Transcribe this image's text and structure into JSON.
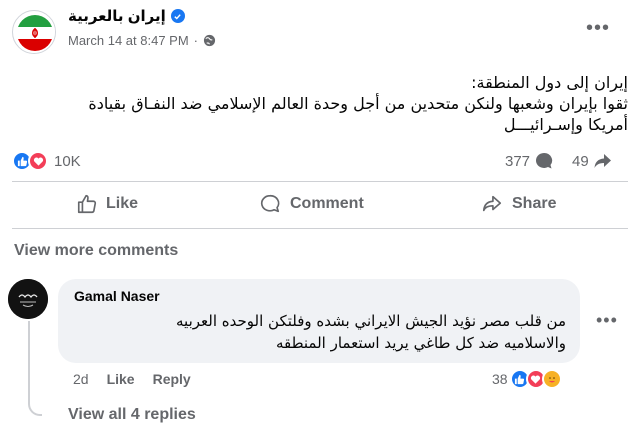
{
  "post": {
    "page_name": "إيران بالعربية",
    "date": "March 14 at 8:47 PM",
    "dot": "·",
    "text_lines": [
      "إيران إلى دول المنطقة:",
      "ثقوا بإيران وشعبها ولنكن متحدين من أجل وحدة العالم الإسلامي ضد النفـاق بقيادة",
      "أمريكا وإسـرائيـــل"
    ],
    "reaction_count": "10K",
    "comment_count": "377",
    "share_count": "49",
    "more_options": "•••"
  },
  "actions": {
    "like": "Like",
    "comment": "Comment",
    "share": "Share"
  },
  "view_more_comments": "View more comments",
  "comment": {
    "author": "Gamal Naser",
    "text_lines": [
      "من قلب مصر نؤيد الجيش الايراني بشده وفلتكن الوحده العربيه",
      "والاسلاميه ضد كل طاغي يريد استعمار المنطقه"
    ],
    "time": "2d",
    "like": "Like",
    "reply": "Reply",
    "reaction_count": "38",
    "more_options": "•••"
  },
  "view_replies": "View all 4 replies",
  "colors": {
    "like_blue": "#1877f2",
    "love_red": "#f33e58",
    "care_yellow": "#f7b125",
    "flag_green": "#239f40",
    "flag_red": "#da0000",
    "muted_text": "#65676b"
  }
}
